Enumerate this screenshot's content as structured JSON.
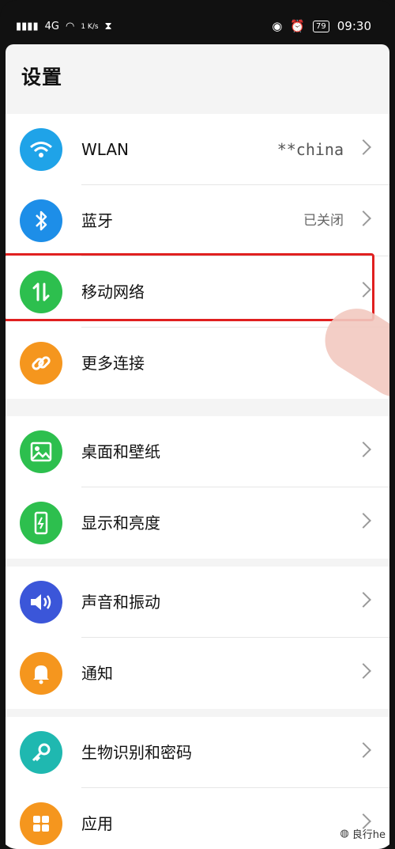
{
  "status_bar": {
    "left_text": "4G",
    "speed": "1 K/s",
    "battery": "79",
    "time": "09:30"
  },
  "page": {
    "title": "设置"
  },
  "groups": [
    {
      "items": [
        {
          "label": "WLAN",
          "value": "**china",
          "icon": "wifi-icon",
          "color": "#1fa3e8"
        },
        {
          "label": "蓝牙",
          "value": "已关闭",
          "icon": "bluetooth-icon",
          "color": "#1d8ee8"
        },
        {
          "label": "移动网络",
          "value": "",
          "icon": "mobile-data-icon",
          "color": "#2dbf4e"
        },
        {
          "label": "更多连接",
          "value": "",
          "icon": "link-icon",
          "color": "#f5961e"
        }
      ]
    },
    {
      "items": [
        {
          "label": "桌面和壁纸",
          "value": "",
          "icon": "wallpaper-icon",
          "color": "#2dbf4e"
        },
        {
          "label": "显示和亮度",
          "value": "",
          "icon": "display-icon",
          "color": "#2dbf4e"
        }
      ]
    },
    {
      "items": [
        {
          "label": "声音和振动",
          "value": "",
          "icon": "sound-icon",
          "color": "#3b56d9"
        },
        {
          "label": "通知",
          "value": "",
          "icon": "bell-icon",
          "color": "#f5961e"
        }
      ]
    },
    {
      "items": [
        {
          "label": "生物识别和密码",
          "value": "",
          "icon": "key-icon",
          "color": "#1fb8b0"
        },
        {
          "label": "应用",
          "value": "",
          "icon": "apps-icon",
          "color": "#f5961e"
        }
      ]
    }
  ],
  "watermark": "良行he",
  "highlight_color": "#e02020"
}
